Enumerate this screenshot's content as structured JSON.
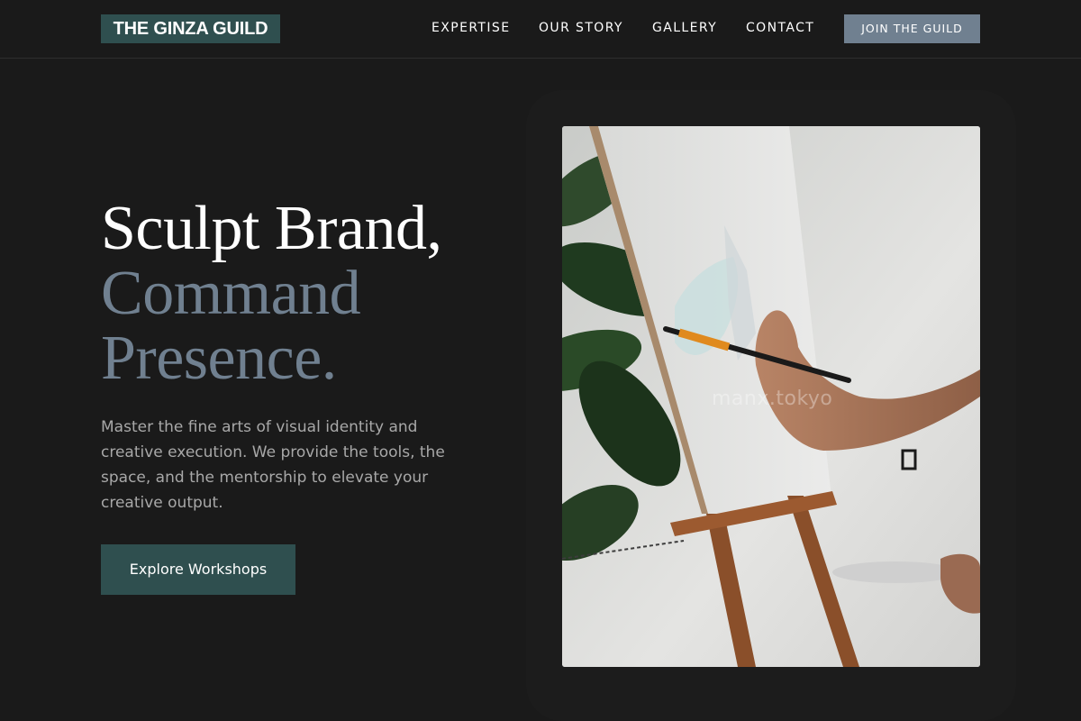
{
  "header": {
    "logo_text": "THE GINZA GUILD",
    "nav": {
      "expertise": "EXPERTISE",
      "story": "OUR STORY",
      "gallery": "GALLERY",
      "contact": "CONTACT"
    },
    "join_label": "JOIN THE GUILD"
  },
  "hero": {
    "headline_line1": "Sculpt Brand,",
    "headline_line2": "Command",
    "headline_line3": "Presence.",
    "description": "Master the fine arts of visual identity and creative execution. We provide the tools, the space, and the mentorship to elevate your creative output.",
    "cta_label": "Explore Workshops",
    "image_watermark": "manx.tokyo"
  },
  "colors": {
    "background": "#1a1a1a",
    "brand_green": "#2f4f4f",
    "slate": "#708090",
    "text_muted": "#a8a8a8"
  }
}
